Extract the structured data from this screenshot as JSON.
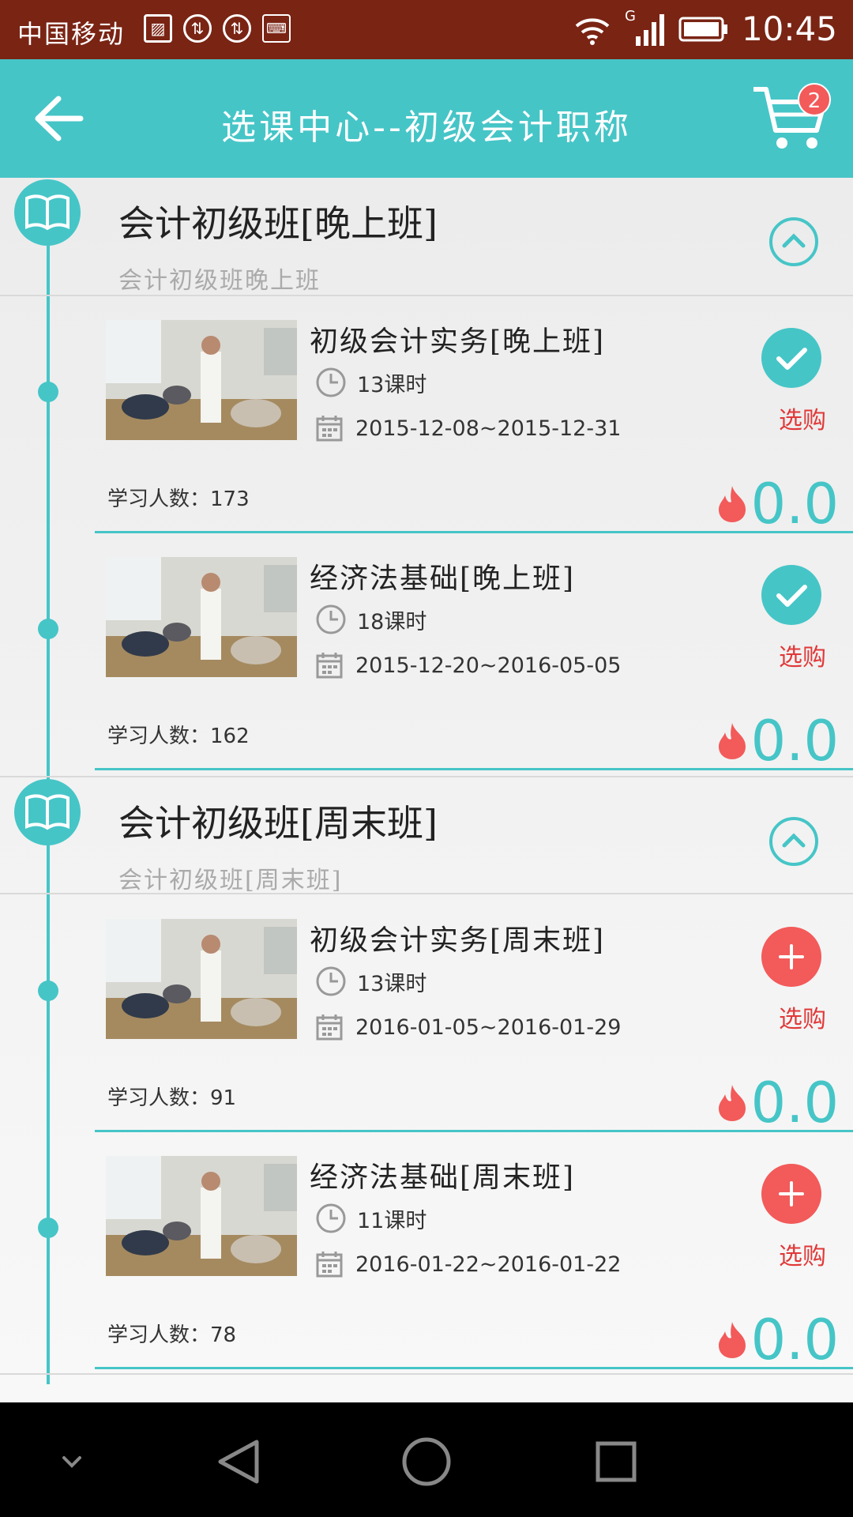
{
  "status_bar": {
    "carrier": "中国移动",
    "network": "G",
    "time": "10:45"
  },
  "header": {
    "title": "选课中心--初级会计职称",
    "cart_count": "2"
  },
  "sections": [
    {
      "title": "会计初级班[晚上班]",
      "subtitle": "会计初级班晚上班",
      "courses": [
        {
          "title": "初级会计实务[晚上班]",
          "hours": "13课时",
          "dates": "2015-12-08~2015-12-31",
          "learners": "学习人数：173",
          "price": "0.0",
          "status": "selected",
          "buy_label": "选购"
        },
        {
          "title": "经济法基础[晚上班]",
          "hours": "18课时",
          "dates": "2015-12-20~2016-05-05",
          "learners": "学习人数：162",
          "price": "0.0",
          "status": "selected",
          "buy_label": "选购"
        }
      ]
    },
    {
      "title": "会计初级班[周末班]",
      "subtitle": "会计初级班[周末班]",
      "courses": [
        {
          "title": "初级会计实务[周末班]",
          "hours": "13课时",
          "dates": "2016-01-05~2016-01-29",
          "learners": "学习人数：91",
          "price": "0.0",
          "status": "add",
          "buy_label": "选购"
        },
        {
          "title": "经济法基础[周末班]",
          "hours": "11课时",
          "dates": "2016-01-22~2016-01-22",
          "learners": "学习人数：78",
          "price": "0.0",
          "status": "add",
          "buy_label": "选购"
        }
      ]
    }
  ],
  "colors": {
    "accent": "#46c5c7",
    "status_bar": "#7a2414",
    "add": "#f35a5a",
    "buy_text": "#e13838"
  },
  "nav_bar": {
    "icons": [
      "chevron-down-icon",
      "back-triangle-icon",
      "home-circle-icon",
      "recents-square-icon"
    ]
  }
}
